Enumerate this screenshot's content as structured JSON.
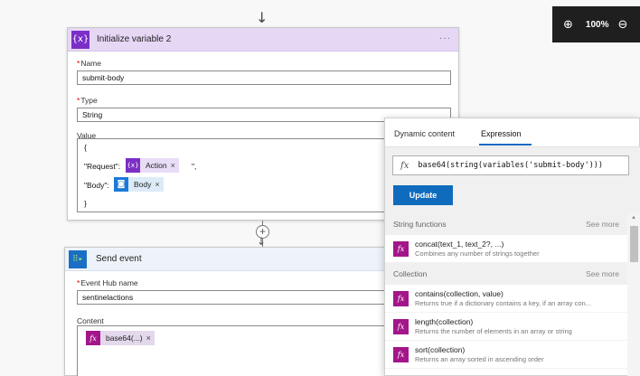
{
  "toolbar": {
    "zoom_level": "100%",
    "zoom_in_icon": "zoom-in-icon",
    "zoom_out_icon": "zoom-out-icon"
  },
  "flow": {
    "top_arrow": "↓"
  },
  "init_variable": {
    "title": "Initialize variable 2",
    "icon_text": "{x}",
    "more": "···",
    "name_label": "Name",
    "name_value": "submit-body",
    "type_label": "Type",
    "type_value": "String",
    "value_label": "Value",
    "value_lines": {
      "open_brace": "{",
      "request_key": "\"Request\":",
      "request_suffix": "\",",
      "body_key": "\"Body\":",
      "close_brace": "}"
    },
    "tokens": {
      "action_icon": "{x}",
      "action_label": "Action",
      "body_label": "Body",
      "remove": "×"
    }
  },
  "connector": {
    "plus": "+",
    "arrow": "↓"
  },
  "send_event": {
    "title": "Send event",
    "icon_text": "⠿▸",
    "hub_label": "Event Hub name",
    "hub_value": "sentinelactions",
    "content_label": "Content",
    "token_label": "base64(...)",
    "token_icon": "fx",
    "remove": "×"
  },
  "dynamic_panel": {
    "tabs": [
      "Dynamic content",
      "Expression"
    ],
    "active_tab": "Expression",
    "expression_icon": "fx",
    "expression": "base64(string(variables('submit-body')))",
    "update_label": "Update",
    "sections": [
      {
        "title": "String functions",
        "see_more": "See more",
        "functions": [
          {
            "name": "concat(text_1, text_2?, ...)",
            "desc": "Combines any number of strings together"
          }
        ]
      },
      {
        "title": "Collection",
        "see_more": "See more",
        "functions": [
          {
            "name": "contains(collection, value)",
            "desc": "Returns true if a dictionary contains a key, if an array con..."
          },
          {
            "name": "length(collection)",
            "desc": "Returns the number of elements in an array or string"
          },
          {
            "name": "sort(collection)",
            "desc": "Returns an array sorted in ascending order"
          }
        ]
      }
    ],
    "function_icon": "fx"
  },
  "colors": {
    "variable_accent": "#7b2fc6",
    "variable_header": "#e6d7f5",
    "expression_icon": "#a3168a",
    "primary_button": "#0f6cbd"
  }
}
